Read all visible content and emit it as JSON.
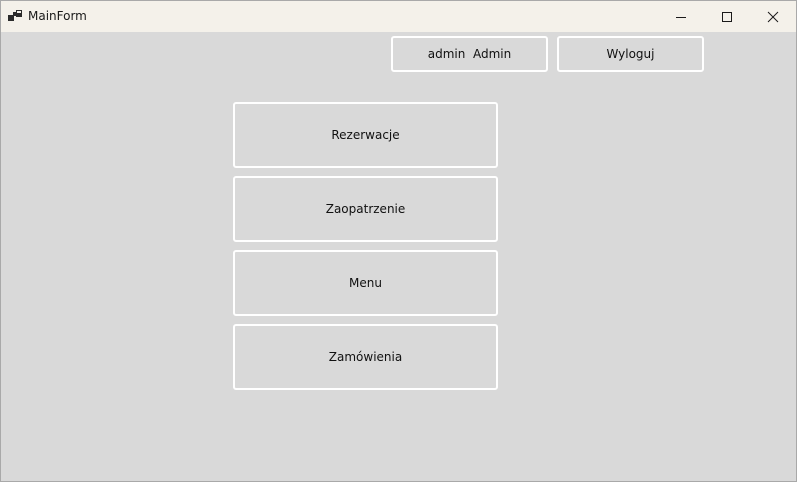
{
  "window": {
    "title": "MainForm",
    "app_icon": "winforms-app-icon",
    "controls": [
      {
        "name": "minimize",
        "icon": "minimize-icon"
      },
      {
        "name": "maximize",
        "icon": "maximize-icon"
      },
      {
        "name": "close",
        "icon": "close-icon"
      }
    ]
  },
  "header": {
    "user_label": "admin  Admin",
    "logout_label": "Wyloguj"
  },
  "menu": {
    "items": [
      {
        "label": "Rezerwacje"
      },
      {
        "label": "Zaopatrzenie"
      },
      {
        "label": "Menu"
      },
      {
        "label": "Zamówienia"
      }
    ]
  },
  "colors": {
    "background": "#d9d9d9",
    "titlebar": "#f4f1ea",
    "button_border": "#ffffff",
    "text": "#111111"
  }
}
